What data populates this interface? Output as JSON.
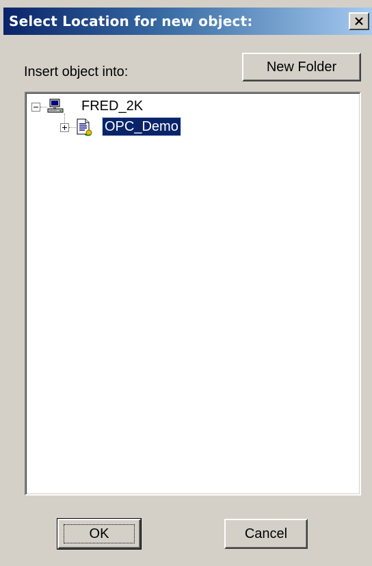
{
  "dialog": {
    "title": "Select Location for new object:",
    "close_glyph": "X",
    "insert_label": "Insert object into:",
    "new_folder_label": "New Folder",
    "ok_label": "OK",
    "cancel_label": "Cancel"
  },
  "tree": {
    "nodes": [
      {
        "label": "FRED_2K",
        "icon": "computer-icon",
        "expanded": true,
        "selected": false
      },
      {
        "label": "OPC_Demo",
        "icon": "document-icon",
        "expanded": false,
        "selected": true
      }
    ]
  },
  "colors": {
    "title_bar_start": "#0a246a",
    "title_bar_end": "#a6caf0",
    "dialog_face": "#d4d0c8",
    "selection": "#0a246a"
  }
}
